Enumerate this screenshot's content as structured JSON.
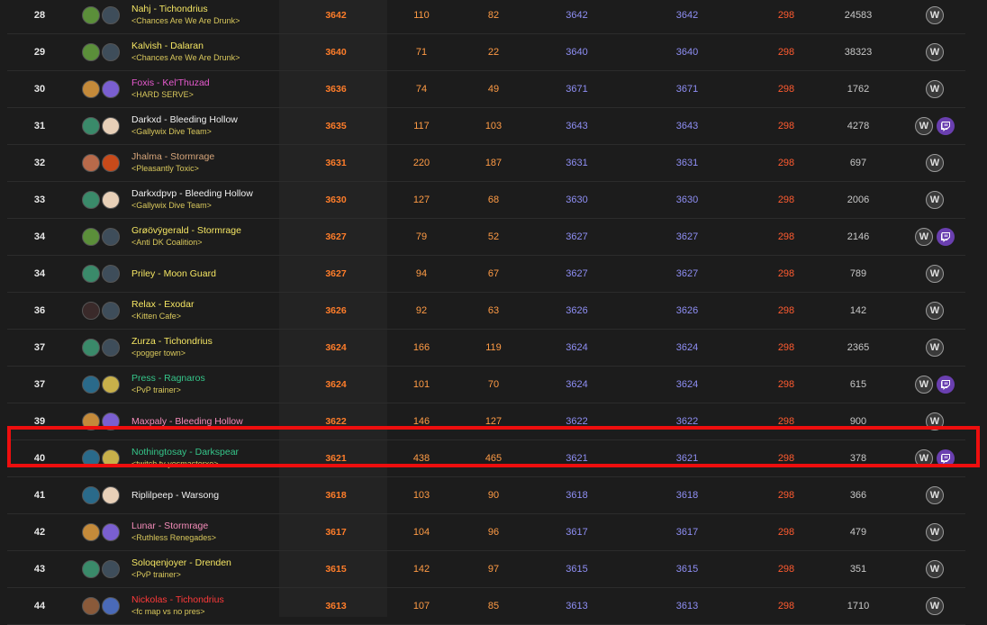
{
  "colors": {
    "death_knight": "#ff4d6a",
    "demon_hunter": "#c06ee0",
    "druid": "#ff8a1f",
    "monk": "#35d6a0",
    "rogue": "#fff569",
    "warlock": "#9b86e8",
    "warrior": "#d6a57a",
    "priest": "#ffffff",
    "paladin": "#f58cba",
    "shaman": "#40a0ff",
    "mage": "#69ccf0",
    "hunter": "#abd473"
  },
  "rows": [
    {
      "rank": "28",
      "name": "Nahj - Tichondrius",
      "guild": "<Chances Are We Are Drunk>",
      "name_color": "#f5e663",
      "race_color": "#5b8f3a",
      "spec_color": "#3e4d5a",
      "rating": "3642",
      "won": "110",
      "lost": "82",
      "current": "3642",
      "highest": "3642",
      "season": "298",
      "achievement": "24583",
      "twitch": false
    },
    {
      "rank": "29",
      "name": "Kalvish - Dalaran",
      "guild": "<Chances Are We Are Drunk>",
      "name_color": "#f5e663",
      "race_color": "#5b8f3a",
      "spec_color": "#3e4d5a",
      "rating": "3640",
      "won": "71",
      "lost": "22",
      "current": "3640",
      "highest": "3640",
      "season": "298",
      "achievement": "38323",
      "twitch": false
    },
    {
      "rank": "30",
      "name": "Foxis - Kel'Thuzad",
      "guild": "<HARD SERVE>",
      "name_color": "#e85ad0",
      "race_color": "#c48a3a",
      "spec_color": "#7a5fd0",
      "rating": "3636",
      "won": "74",
      "lost": "49",
      "current": "3671",
      "highest": "3671",
      "season": "298",
      "achievement": "1762",
      "twitch": false
    },
    {
      "rank": "31",
      "name": "Darkxd - Bleeding Hollow",
      "guild": "<Gallywix Dive Team>",
      "name_color": "#f0f0f0",
      "race_color": "#3a8a6a",
      "spec_color": "#e8d0b8",
      "rating": "3635",
      "won": "117",
      "lost": "103",
      "current": "3643",
      "highest": "3643",
      "season": "298",
      "achievement": "4278",
      "twitch": true
    },
    {
      "rank": "32",
      "name": "Jhalma - Stormrage",
      "guild": "<Pleasantly Toxic>",
      "name_color": "#d6a57a",
      "race_color": "#b86a4a",
      "spec_color": "#c84a1a",
      "rating": "3631",
      "won": "220",
      "lost": "187",
      "current": "3631",
      "highest": "3631",
      "season": "298",
      "achievement": "697",
      "twitch": false
    },
    {
      "rank": "33",
      "name": "Darkxdpvp - Bleeding Hollow",
      "guild": "<Gallywix Dive Team>",
      "name_color": "#f0f0f0",
      "race_color": "#3a8a6a",
      "spec_color": "#e8d0b8",
      "rating": "3630",
      "won": "127",
      "lost": "68",
      "current": "3630",
      "highest": "3630",
      "season": "298",
      "achievement": "2006",
      "twitch": false
    },
    {
      "rank": "34",
      "name": "Grøövÿgerald - Stormrage",
      "guild": "<Anti DK Coalition>",
      "name_color": "#f5e663",
      "race_color": "#5b8f3a",
      "spec_color": "#3e4d5a",
      "rating": "3627",
      "won": "79",
      "lost": "52",
      "current": "3627",
      "highest": "3627",
      "season": "298",
      "achievement": "2146",
      "twitch": true
    },
    {
      "rank": "34",
      "name": "Priley - Moon Guard",
      "guild": "",
      "name_color": "#f5e663",
      "race_color": "#3a8a6a",
      "spec_color": "#3e4d5a",
      "rating": "3627",
      "won": "94",
      "lost": "67",
      "current": "3627",
      "highest": "3627",
      "season": "298",
      "achievement": "789",
      "twitch": false
    },
    {
      "rank": "36",
      "name": "Relax - Exodar",
      "guild": "<Kitten Cafe>",
      "name_color": "#f5e663",
      "race_color": "#3a2a2a",
      "spec_color": "#3e4d5a",
      "rating": "3626",
      "won": "92",
      "lost": "63",
      "current": "3626",
      "highest": "3626",
      "season": "298",
      "achievement": "142",
      "twitch": false
    },
    {
      "rank": "37",
      "name": "Zurza - Tichondrius",
      "guild": "<pogger town>",
      "name_color": "#f5e663",
      "race_color": "#3a8a6a",
      "spec_color": "#3e4d5a",
      "rating": "3624",
      "won": "166",
      "lost": "119",
      "current": "3624",
      "highest": "3624",
      "season": "298",
      "achievement": "2365",
      "twitch": false
    },
    {
      "rank": "37",
      "name": "Press - Ragnaros",
      "guild": "<PvP trainer>",
      "name_color": "#35c68a",
      "race_color": "#2a6a8a",
      "spec_color": "#c8b04a",
      "rating": "3624",
      "won": "101",
      "lost": "70",
      "current": "3624",
      "highest": "3624",
      "season": "298",
      "achievement": "615",
      "twitch": true
    },
    {
      "rank": "39",
      "name": "Maxpaly - Bleeding Hollow",
      "guild": "",
      "name_color": "#f58cba",
      "race_color": "#c48a3a",
      "spec_color": "#7a5fd0",
      "rating": "3622",
      "won": "146",
      "lost": "127",
      "current": "3622",
      "highest": "3622",
      "season": "298",
      "achievement": "900",
      "twitch": false
    },
    {
      "rank": "40",
      "name": "Nothingtosay - Darkspear",
      "guild": "<twitch tv yesmasterxo>",
      "name_color": "#35c68a",
      "race_color": "#2a6a8a",
      "spec_color": "#c8b04a",
      "rating": "3621",
      "won": "438",
      "lost": "465",
      "current": "3621",
      "highest": "3621",
      "season": "298",
      "achievement": "378",
      "twitch": true
    },
    {
      "rank": "41",
      "name": "Riplilpeep - Warsong",
      "guild": "",
      "name_color": "#f0f0f0",
      "race_color": "#2a6a8a",
      "spec_color": "#e8d0b8",
      "rating": "3618",
      "won": "103",
      "lost": "90",
      "current": "3618",
      "highest": "3618",
      "season": "298",
      "achievement": "366",
      "twitch": false
    },
    {
      "rank": "42",
      "name": "Lunar - Stormrage",
      "guild": "<Ruthless Renegades>",
      "name_color": "#f58cba",
      "race_color": "#c48a3a",
      "spec_color": "#7a5fd0",
      "rating": "3617",
      "won": "104",
      "lost": "96",
      "current": "3617",
      "highest": "3617",
      "season": "298",
      "achievement": "479",
      "twitch": false
    },
    {
      "rank": "43",
      "name": "Soloqenjoyer - Drenden",
      "guild": "<PvP trainer>",
      "name_color": "#f5e663",
      "race_color": "#3a8a6a",
      "spec_color": "#3e4d5a",
      "rating": "3615",
      "won": "142",
      "lost": "97",
      "current": "3615",
      "highest": "3615",
      "season": "298",
      "achievement": "351",
      "twitch": false
    },
    {
      "rank": "44",
      "name": "Nickolas - Tichondrius",
      "guild": "<fc map vs no pres>",
      "name_color": "#ff3a3a",
      "race_color": "#8a5a3a",
      "spec_color": "#4a6ab8",
      "rating": "3613",
      "won": "107",
      "lost": "85",
      "current": "3613",
      "highest": "3613",
      "season": "298",
      "achievement": "1710",
      "twitch": false
    }
  ],
  "wow_icon_label": "W"
}
